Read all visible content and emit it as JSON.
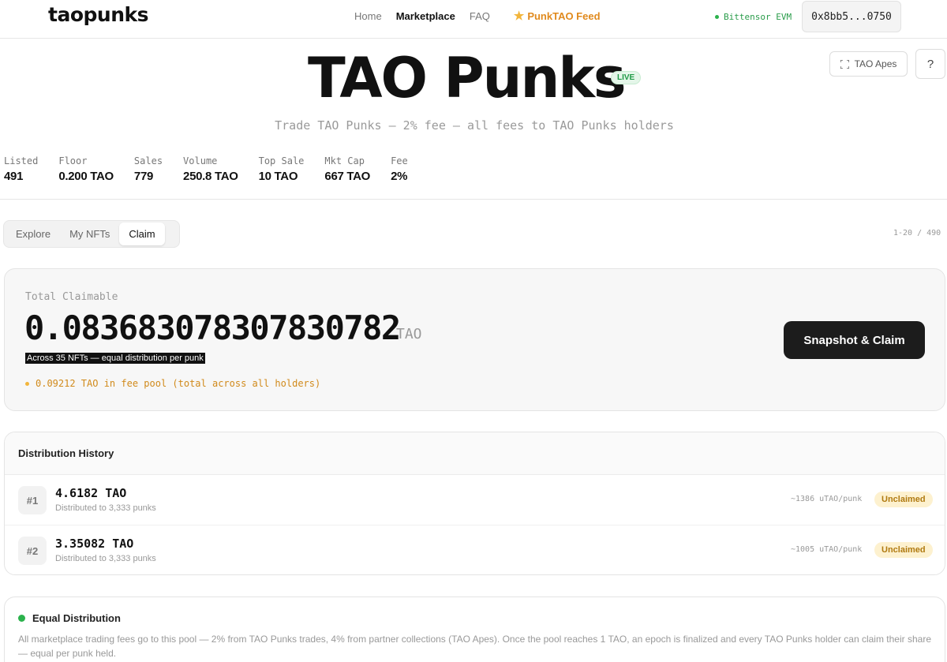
{
  "nav": {
    "logo": "taopunks",
    "links": [
      "Home",
      "Marketplace",
      "FAQ"
    ],
    "feed": "PunkTAO Feed",
    "network": "Bittensor EVM",
    "wallet": "0x8bb5...0750"
  },
  "hero": {
    "title": "TAO Punks",
    "badge": "LIVE",
    "subtitle": "Trade TAO Punks — 2% fee — all fees to TAO Punks holders",
    "apes_button": "TAO Apes",
    "help": "?"
  },
  "stats": [
    {
      "label": "Listed",
      "value": "491"
    },
    {
      "label": "Floor",
      "value": "0.200 TAO"
    },
    {
      "label": "Sales",
      "value": "779"
    },
    {
      "label": "Volume",
      "value": "250.8 TAO"
    },
    {
      "label": "Top Sale",
      "value": "10 TAO"
    },
    {
      "label": "Mkt Cap",
      "value": "667 TAO"
    },
    {
      "label": "Fee",
      "value": "2%"
    }
  ],
  "tabs": [
    "Explore",
    "My NFTs",
    "Claim"
  ],
  "pager": "1-20 / 490",
  "claim": {
    "label": "Total Claimable",
    "amount": "0.083683078307830782",
    "unit": "TAO",
    "note": "Across 35 NFTs — equal distribution per punk",
    "fee_pool": "0.09212 TAO in fee pool (total across all holders)",
    "button": "Snapshot & Claim"
  },
  "history": {
    "title": "Distribution History",
    "rows": [
      {
        "epoch": "#1",
        "amount": "4.6182 TAO",
        "sub": "Distributed to 3,333 punks",
        "rate": "~1386 uTAO/punk",
        "status": "Unclaimed"
      },
      {
        "epoch": "#2",
        "amount": "3.35082 TAO",
        "sub": "Distributed to 3,333 punks",
        "rate": "~1005 uTAO/punk",
        "status": "Unclaimed"
      }
    ]
  },
  "equal": {
    "title": "Equal Distribution",
    "text": "All marketplace trading fees go to this pool — 2% from TAO Punks trades, 4% from partner collections (TAO Apes). Once the pool reaches 1 TAO, an epoch is finalized and every TAO Punks holder can claim their share — equal per punk held."
  },
  "colors": {
    "accent_orange": "#e08a1e",
    "live_green": "#1e9a46",
    "unclaimed_bg": "#fdf1cf"
  }
}
